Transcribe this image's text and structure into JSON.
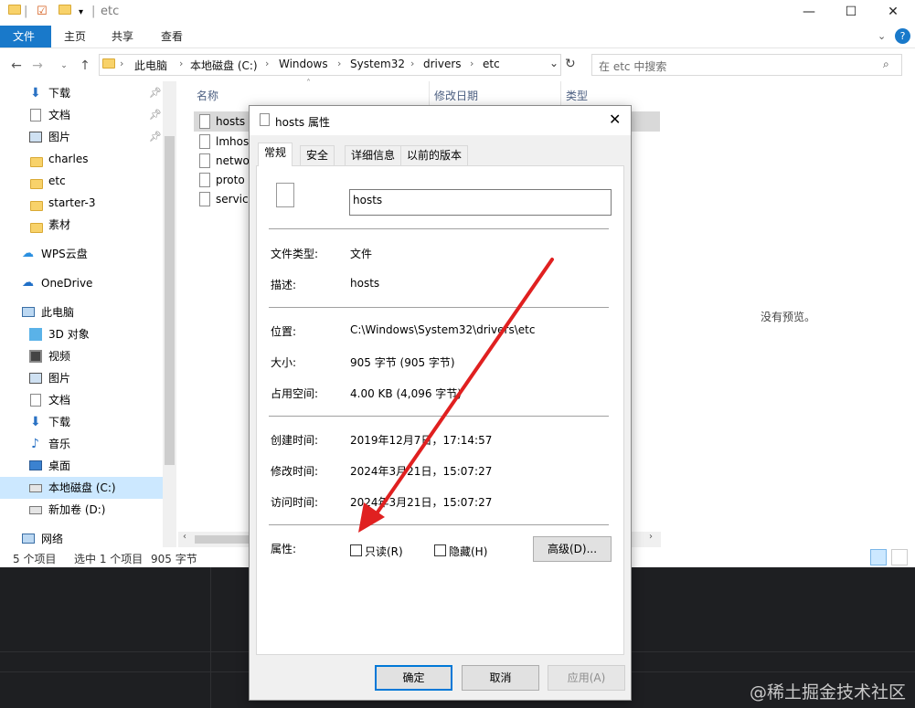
{
  "explorer": {
    "title": "etc",
    "window_controls": {
      "minimize": "—",
      "maximize": "☐",
      "close": "✕"
    },
    "ribbon_tabs": [
      "文件",
      "主页",
      "共享",
      "查看"
    ],
    "breadcrumbs": [
      "此电脑",
      "本地磁盘 (C:)",
      "Windows",
      "System32",
      "drivers",
      "etc"
    ],
    "search_placeholder": "在 etc 中搜索",
    "sidebar": [
      {
        "label": "下载",
        "icon": "download-icon",
        "pinned": true
      },
      {
        "label": "文档",
        "icon": "document-icon",
        "pinned": true
      },
      {
        "label": "图片",
        "icon": "pictures-icon",
        "pinned": true
      },
      {
        "label": "charles",
        "icon": "folder-icon"
      },
      {
        "label": "etc",
        "icon": "folder-icon"
      },
      {
        "label": "starter-3",
        "icon": "folder-icon"
      },
      {
        "label": "素材",
        "icon": "folder-icon"
      },
      {
        "label": "WPS云盘",
        "icon": "cloud-icon"
      },
      {
        "label": "OneDrive",
        "icon": "onedrive-icon"
      },
      {
        "label": "此电脑",
        "icon": "computer-icon"
      },
      {
        "label": "3D 对象",
        "icon": "3d-objects-icon"
      },
      {
        "label": "视频",
        "icon": "video-icon"
      },
      {
        "label": "图片",
        "icon": "pictures-icon"
      },
      {
        "label": "文档",
        "icon": "document-icon"
      },
      {
        "label": "下载",
        "icon": "download-icon"
      },
      {
        "label": "音乐",
        "icon": "music-icon"
      },
      {
        "label": "桌面",
        "icon": "desktop-icon"
      },
      {
        "label": "本地磁盘 (C:)",
        "icon": "drive-icon",
        "selected": true
      },
      {
        "label": "新加卷 (D:)",
        "icon": "drive-icon"
      },
      {
        "label": "网络",
        "icon": "network-icon"
      }
    ],
    "columns": [
      "名称",
      "修改日期",
      "类型"
    ],
    "files": [
      "hosts",
      "lmhos",
      "netwo",
      "proto",
      "service"
    ],
    "preview_text": "没有预览。",
    "status": {
      "count": "5 个项目",
      "selection": "选中 1 个项目",
      "size": "905 字节"
    }
  },
  "dialog": {
    "title": "hosts 属性",
    "close": "✕",
    "tabs": [
      "常规",
      "安全",
      "详细信息",
      "以前的版本"
    ],
    "file_name": "hosts",
    "rows": [
      {
        "label": "文件类型:",
        "value": "文件"
      },
      {
        "label": "描述:",
        "value": "hosts"
      },
      {
        "label": "位置:",
        "value": "C:\\Windows\\System32\\drivers\\etc"
      },
      {
        "label": "大小:",
        "value": "905 字节 (905 字节)"
      },
      {
        "label": "占用空间:",
        "value": "4.00 KB (4,096 字节)"
      },
      {
        "label": "创建时间:",
        "value": "2019年12月7日，17:14:57"
      },
      {
        "label": "修改时间:",
        "value": "2024年3月21日，15:07:27"
      },
      {
        "label": "访问时间:",
        "value": "2024年3月21日，15:07:27"
      }
    ],
    "attributes_label": "属性:",
    "readonly_label": "只读(R)",
    "readonly_checked": false,
    "hidden_label": "隐藏(H)",
    "hidden_checked": false,
    "advanced_button": "高级(D)...",
    "ok_button": "确定",
    "cancel_button": "取消",
    "apply_button": "应用(A)"
  },
  "annotation": {
    "arrow_color": "#e02020"
  },
  "watermark": "@稀土掘金技术社区",
  "colors": {
    "accent": "#1979ca",
    "selection": "#cce8ff"
  }
}
